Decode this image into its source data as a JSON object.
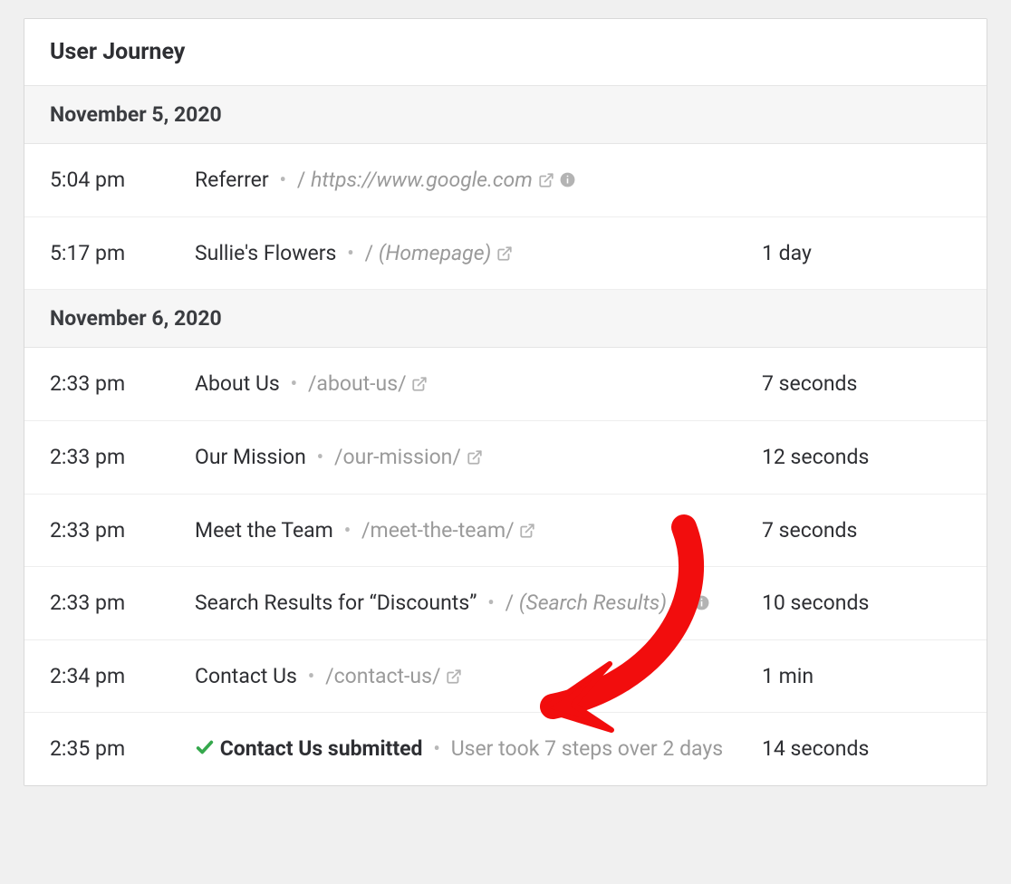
{
  "panel": {
    "title": "User Journey"
  },
  "groups": [
    {
      "date": "November 5, 2020",
      "rows": [
        {
          "time": "5:04 pm",
          "title": "Referrer",
          "titleBold": false,
          "pathPrefix": "/",
          "path": "https://www.google.com",
          "pathItalic": true,
          "hasExternal": true,
          "hasInfo": true,
          "duration": "",
          "hasCheck": false,
          "summary": ""
        },
        {
          "time": "5:17 pm",
          "title": "Sullie's Flowers",
          "titleBold": false,
          "pathPrefix": "/",
          "path": "(Homepage)",
          "pathItalic": true,
          "hasExternal": true,
          "hasInfo": false,
          "duration": "1 day",
          "hasCheck": false,
          "summary": ""
        }
      ]
    },
    {
      "date": "November 6, 2020",
      "rows": [
        {
          "time": "2:33 pm",
          "title": "About Us",
          "titleBold": false,
          "pathPrefix": "",
          "path": "/about-us/",
          "pathItalic": false,
          "hasExternal": true,
          "hasInfo": false,
          "duration": "7 seconds",
          "hasCheck": false,
          "summary": ""
        },
        {
          "time": "2:33 pm",
          "title": "Our Mission",
          "titleBold": false,
          "pathPrefix": "",
          "path": "/our-mission/",
          "pathItalic": false,
          "hasExternal": true,
          "hasInfo": false,
          "duration": "12 seconds",
          "hasCheck": false,
          "summary": ""
        },
        {
          "time": "2:33 pm",
          "title": "Meet the Team",
          "titleBold": false,
          "pathPrefix": "",
          "path": "/meet-the-team/",
          "pathItalic": false,
          "hasExternal": true,
          "hasInfo": false,
          "duration": "7 seconds",
          "hasCheck": false,
          "summary": ""
        },
        {
          "time": "2:33 pm",
          "title": "Search Results for “Discounts”",
          "titleBold": false,
          "pathPrefix": "/",
          "path": "(Search Results)",
          "pathItalic": true,
          "hasExternal": true,
          "hasInfo": true,
          "duration": "10 seconds",
          "hasCheck": false,
          "summary": ""
        },
        {
          "time": "2:34 pm",
          "title": "Contact Us",
          "titleBold": false,
          "pathPrefix": "",
          "path": "/contact-us/",
          "pathItalic": false,
          "hasExternal": true,
          "hasInfo": false,
          "duration": "1 min",
          "hasCheck": false,
          "summary": ""
        },
        {
          "time": "2:35 pm",
          "title": "Contact Us submitted",
          "titleBold": true,
          "pathPrefix": "",
          "path": "",
          "pathItalic": false,
          "hasExternal": false,
          "hasInfo": false,
          "duration": "14 seconds",
          "hasCheck": true,
          "summary": "User took 7 steps over 2 days"
        }
      ]
    }
  ]
}
